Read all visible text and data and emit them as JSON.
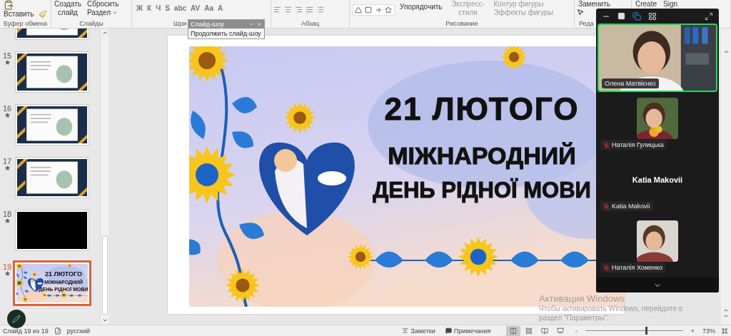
{
  "ribbon": {
    "groups": [
      {
        "kind": "clipboard",
        "label": "Буфер обмена",
        "buttons": [
          "Вставить"
        ]
      },
      {
        "kind": "slides",
        "label": "Слайды",
        "buttons": [
          "Создать слайд",
          "Сбросить",
          "Раздел"
        ]
      },
      {
        "kind": "font",
        "label": "Шри",
        "buttons": [
          "Ж",
          "К",
          "Ч",
          "S",
          "abc",
          "AV",
          "Aa",
          "A"
        ]
      },
      {
        "kind": "paragraph",
        "label": "Абзац"
      },
      {
        "kind": "drawing",
        "label": "Рисование",
        "buttons": [
          "Упорядочить",
          "Экспресс-стили",
          "Контур фигуры",
          "Эффекты фигуры"
        ]
      },
      {
        "kind": "editing",
        "label": "Реда",
        "buttons": [
          "Заменить"
        ]
      },
      {
        "kind": "adobe",
        "buttons": [
          "Create",
          "Sign"
        ]
      }
    ]
  },
  "slideshow_toolbar": {
    "title": "Слайд-шоу",
    "items": [
      "Продолжить слайд-шоу"
    ]
  },
  "thumbnails": [
    {
      "kind": "partial",
      "selected": false
    },
    {
      "number": "15",
      "kind": "page",
      "selected": false
    },
    {
      "number": "16",
      "kind": "page",
      "selected": false
    },
    {
      "number": "17",
      "kind": "page",
      "selected": false
    },
    {
      "number": "18",
      "kind": "black",
      "selected": false
    },
    {
      "number": "19",
      "kind": "title",
      "selected": true,
      "lines": [
        "21 ЛЮТОГО",
        "МІЖНАРОДНИЙ",
        "ДЕНЬ РІДНОЇ МОВИ"
      ]
    }
  ],
  "slide": {
    "lines": [
      "21 ЛЮТОГО",
      "МІЖНАРОДНИЙ",
      "ДЕНЬ РІДНОЇ МОВИ"
    ]
  },
  "zoom_panel": {
    "view_buttons": [
      {
        "kind": "minimize",
        "selected": false
      },
      {
        "kind": "single",
        "selected": false
      },
      {
        "kind": "speaker",
        "selected": true
      },
      {
        "kind": "gallery",
        "selected": false
      }
    ],
    "participants": [
      {
        "name": "Олена Матвієнко",
        "kind": "video",
        "active": true,
        "muted": false
      },
      {
        "name": "Наталія Гулицька",
        "active": false,
        "muted": true
      },
      {
        "name": "Katia Makovii",
        "kind": "name",
        "display_name": "Katia Makovii",
        "active": false,
        "muted": true
      },
      {
        "name": "Наталія Хоменко",
        "active": false,
        "muted": true
      }
    ]
  },
  "status_bar": {
    "slide": "Слайд 19 из 19",
    "language": "русский",
    "notes": "Заметки",
    "comments": "Примечания",
    "views": [
      {
        "selected": true
      },
      {
        "selected": false
      },
      {
        "selected": false
      },
      {
        "selected": false
      }
    ],
    "zoom": {
      "minus": "-",
      "plus": "+",
      "level": 0.62,
      "value": "73%"
    }
  },
  "activation": {
    "title": "Активация Windows",
    "lines": [
      "Чтобы активировать Windows, перейдите в",
      "раздел \"Параметры\"."
    ]
  }
}
